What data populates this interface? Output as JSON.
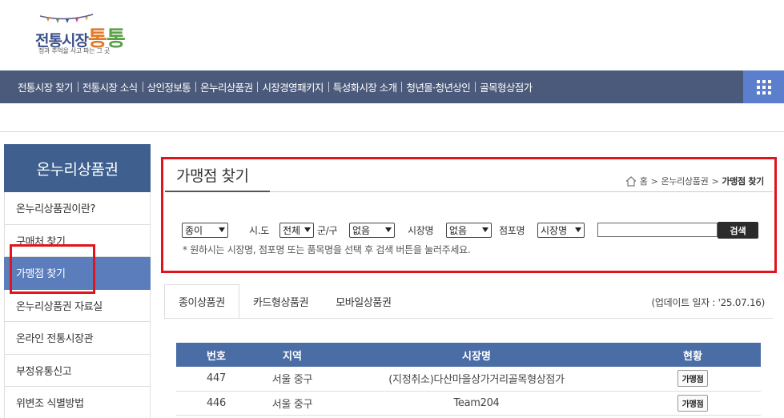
{
  "logo": {
    "title_a": "전통시장",
    "title_b": "통",
    "title_c": "통",
    "subtitle": "정과 추억을 사고 파는 그 곳"
  },
  "nav": {
    "items": [
      "전통시장 찾기",
      "전통시장 소식",
      "상인정보통",
      "온누리상품권",
      "시장경영패키지",
      "특성화시장 소개",
      "청년몰·청년상인",
      "골목형상점가"
    ],
    "menu_icon": "grid-menu-icon"
  },
  "sidebar": {
    "title": "온누리상품권",
    "items": [
      "온누리상품권이란?",
      "구매처 찾기",
      "가맹점 찾기",
      "온누리상품권 자료실",
      "온라인 전통시장관",
      "부정유통신고",
      "위변조 식별방법"
    ],
    "active_index": 2
  },
  "main": {
    "title": "가맹점 찾기",
    "breadcrumb": {
      "home": "홈",
      "sep": ">",
      "section": "온누리상품권",
      "current": "가맹점 찾기"
    }
  },
  "search": {
    "type_select": "종이",
    "sido_label": "시.도",
    "sido_select": "전체",
    "gungu_label": "군/구",
    "gungu_select": "없음",
    "market_label": "시장명",
    "market_select": "없음",
    "store_label": "점포명",
    "store_select": "시장명",
    "input_value": "",
    "button": "검색",
    "hint": "* 원하시는 시장명, 점포명 또는 품목명을 선택 후 검색 버튼을 눌러주세요."
  },
  "tabs": [
    "종이상품권",
    "카드형상품권",
    "모바일상품권"
  ],
  "update_text": "(업데이트 일자 : '25.07.16)",
  "table": {
    "headers": [
      "번호",
      "지역",
      "시장명",
      "현황"
    ],
    "rows": [
      {
        "no": "447",
        "region": "서울 중구",
        "market": "(지정취소)다산마을상가거리골목형상점가",
        "action": "가맹점"
      },
      {
        "no": "446",
        "region": "서울 중구",
        "market": "Team204",
        "action": "가맹점"
      }
    ]
  },
  "colors": {
    "nav_bg": "#4b5a7a",
    "accent": "#5c7dbc",
    "table_header": "#4b6da5",
    "highlight": "#e0141c"
  }
}
